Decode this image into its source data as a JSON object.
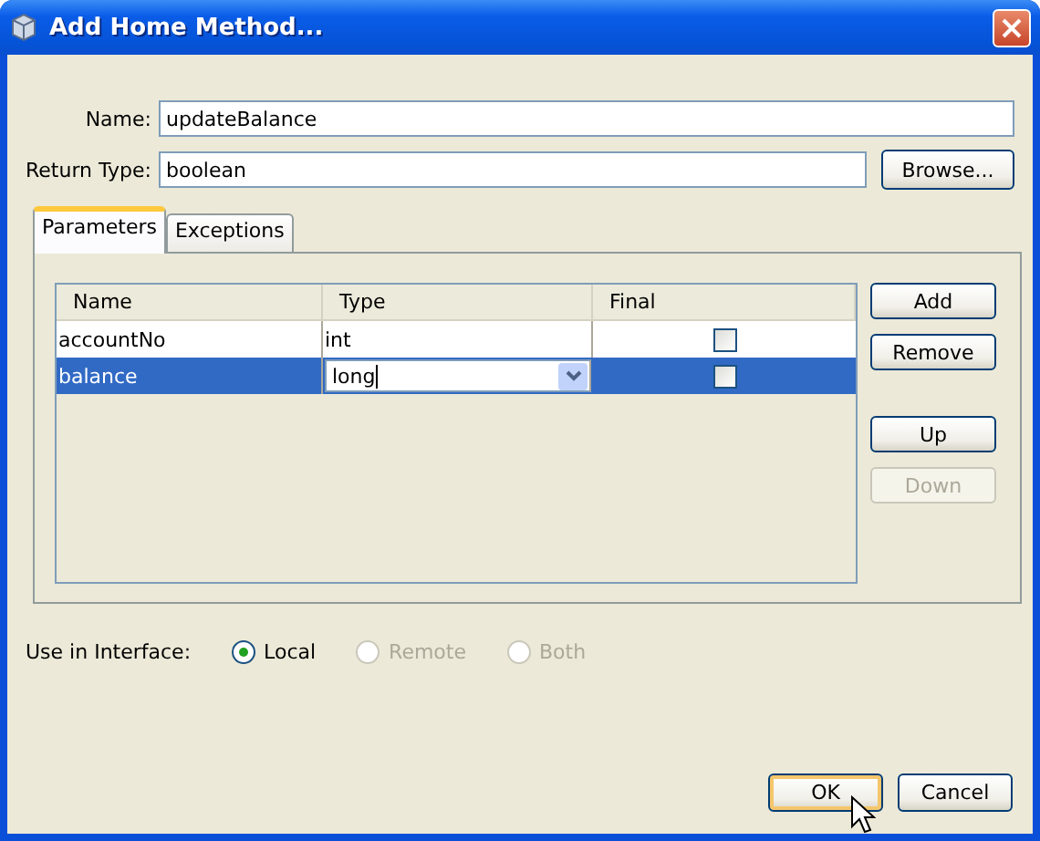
{
  "window": {
    "title": "Add Home Method..."
  },
  "form": {
    "name": {
      "label": "Name:",
      "value": "updateBalance"
    },
    "return_type": {
      "label": "Return Type:",
      "value": "boolean"
    },
    "browse_button": "Browse..."
  },
  "tabs": [
    {
      "label": "Parameters",
      "selected": true
    },
    {
      "label": "Exceptions",
      "selected": false
    }
  ],
  "table": {
    "columns": [
      "Name",
      "Type",
      "Final"
    ],
    "rows": [
      {
        "name": "accountNo",
        "type": "int",
        "final": false,
        "selected": false,
        "editing": false
      },
      {
        "name": "balance",
        "type": "long",
        "final": false,
        "selected": true,
        "editing": true
      }
    ]
  },
  "side_buttons": [
    {
      "label": "Add",
      "disabled": false
    },
    {
      "label": "Remove",
      "disabled": false
    },
    {
      "label": "Up",
      "disabled": false
    },
    {
      "label": "Down",
      "disabled": true
    }
  ],
  "interface": {
    "label": "Use in Interface:",
    "options": [
      {
        "label": "Local",
        "selected": true,
        "disabled": false
      },
      {
        "label": "Remote",
        "selected": false,
        "disabled": true
      },
      {
        "label": "Both",
        "selected": false,
        "disabled": true
      }
    ]
  },
  "buttons": [
    {
      "label": "OK",
      "default": true
    },
    {
      "label": "Cancel",
      "default": false
    }
  ]
}
